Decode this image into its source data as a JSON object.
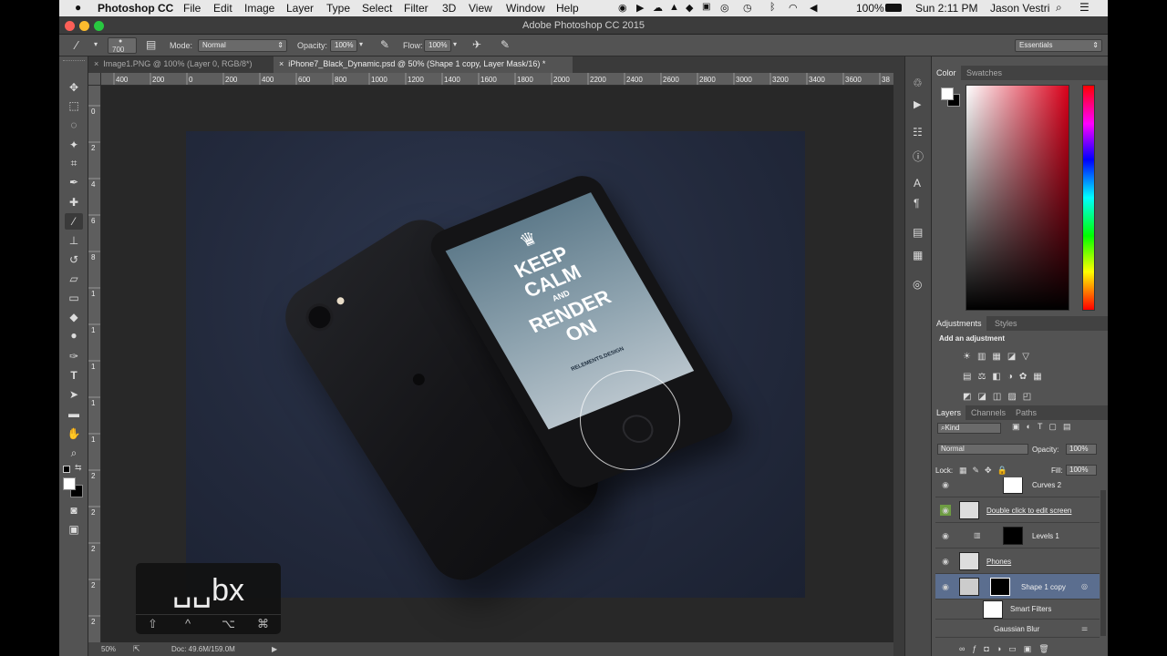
{
  "menubar": {
    "app_name": "Photoshop CC",
    "items": [
      "File",
      "Edit",
      "Image",
      "Layer",
      "Type",
      "Select",
      "Filter",
      "3D",
      "View",
      "Window",
      "Help"
    ],
    "battery": "100%",
    "clock": "Sun 2:11 PM",
    "user": "Jason Vestri"
  },
  "window": {
    "title": "Adobe Photoshop CC 2015"
  },
  "options": {
    "brush_size": "700",
    "mode_label": "Mode:",
    "mode_value": "Normal",
    "opacity_label": "Opacity:",
    "opacity_value": "100%",
    "flow_label": "Flow:",
    "flow_value": "100%",
    "workspace": "Essentials"
  },
  "tabs": [
    {
      "label": "Image1.PNG @ 100% (Layer 0, RGB/8*)"
    },
    {
      "label": "iPhone7_Black_Dynamic.psd @ 50% (Shape 1 copy, Layer Mask/16) *"
    }
  ],
  "ruler_top": [
    "400",
    "200",
    "0",
    "200",
    "400",
    "600",
    "800",
    "1000",
    "1200",
    "1400",
    "1600",
    "1800",
    "2000",
    "2200",
    "2400",
    "2600",
    "2800",
    "3000",
    "3200",
    "3400",
    "3600",
    "38"
  ],
  "ruler_left": [
    "0",
    "2",
    "4",
    "6",
    "8",
    "1",
    "1",
    "1",
    "1",
    "1",
    "2",
    "2",
    "2",
    "2",
    "2"
  ],
  "screen_text": {
    "line1": "KEEP",
    "line2": "CALM",
    "line3": "AND",
    "line4": "RENDER",
    "line5": "ON",
    "brand": "RELEMENTS.DESIGN"
  },
  "status": {
    "zoom": "50%",
    "doc": "Doc: 49.6M/159.0M"
  },
  "hud": {
    "text": "␣␣bx",
    "keys": [
      "⇧",
      "^",
      "⌥",
      "⌘"
    ]
  },
  "color_panel": {
    "tabs": [
      "Color",
      "Swatches"
    ],
    "accent": "#d9001a"
  },
  "adjustments_panel": {
    "tabs": [
      "Adjustments",
      "Styles"
    ],
    "heading": "Add an adjustment"
  },
  "layers_panel": {
    "tabs": [
      "Layers",
      "Channels",
      "Paths"
    ],
    "filter": "Kind",
    "blend_mode": "Normal",
    "opacity_label": "Opacity:",
    "opacity_value": "100%",
    "lock_label": "Lock:",
    "fill_label": "Fill:",
    "fill_value": "100%",
    "layers": [
      {
        "name": "Curves 2"
      },
      {
        "name": "Double click to edit screen"
      },
      {
        "name": "Levels 1"
      },
      {
        "name": "Phones"
      },
      {
        "name": "Shape 1 copy"
      },
      {
        "name": "Smart Filters"
      },
      {
        "name": "Gaussian Blur"
      }
    ]
  }
}
